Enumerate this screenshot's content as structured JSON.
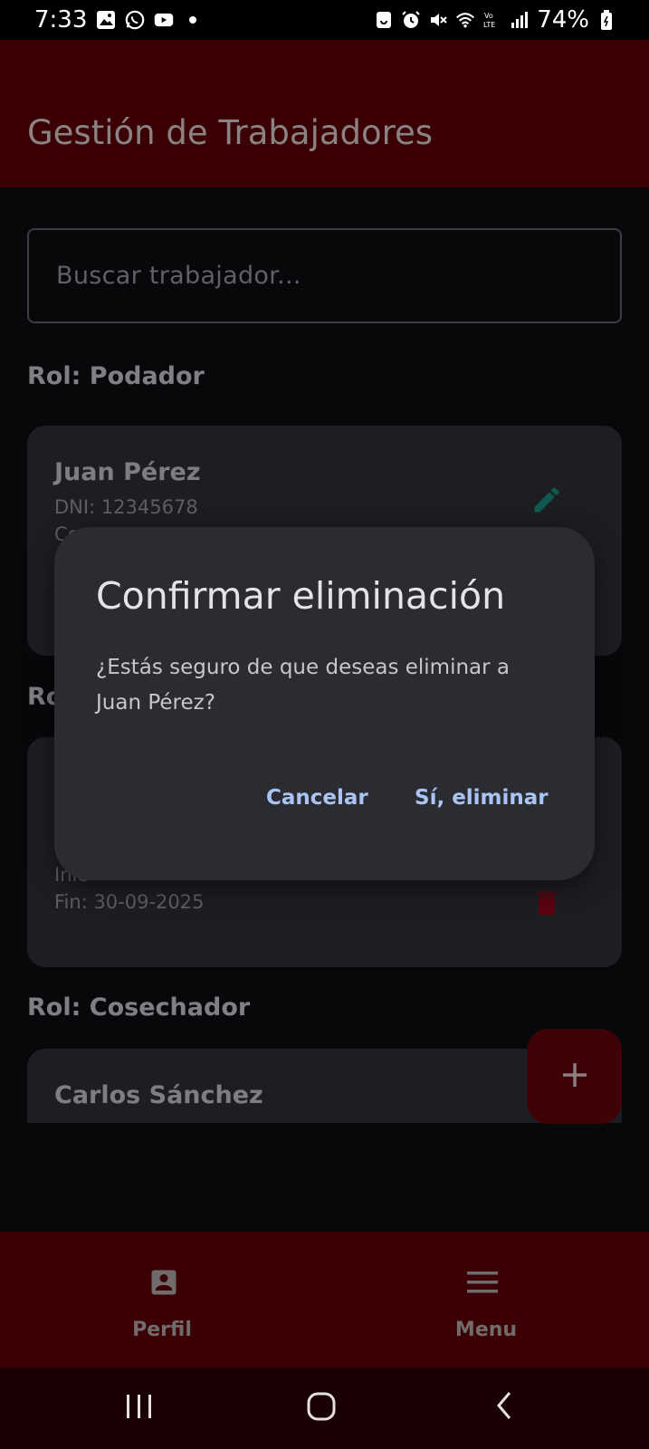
{
  "status_bar": {
    "time": "7:33",
    "battery": "74%",
    "left_icons": [
      "gallery-icon",
      "whatsapp-icon",
      "youtube-icon",
      "dot-icon"
    ],
    "right_icons": [
      "lock-icon",
      "alarm-icon",
      "mute-icon",
      "wifi-icon",
      "volte-icon",
      "signal-icon",
      "battery-icon"
    ]
  },
  "app_bar": {
    "title": "Gestión de Trabajadores"
  },
  "search": {
    "placeholder": "Buscar trabajador..."
  },
  "sections": [
    {
      "heading": "Rol: Podador",
      "card": {
        "name": "Juan Pérez",
        "lines": [
          "DNI: 12345678",
          "Co"
        ]
      }
    },
    {
      "heading": "Ro",
      "card": {
        "lines": [
          "Inic",
          "Fin: 30-09-2025"
        ]
      }
    },
    {
      "heading": "Rol: Cosechador",
      "card": {
        "name": "Carlos Sánchez"
      }
    }
  ],
  "dialog": {
    "title": "Confirmar eliminación",
    "message": "¿Estás seguro de que deseas eliminar a Juan Pérez?",
    "cancel_label": "Cancelar",
    "confirm_label": "Sí, eliminar"
  },
  "bottom_nav": [
    {
      "label": "Perfil",
      "icon": "profile-icon"
    },
    {
      "label": "Menu",
      "icon": "menu-icon"
    }
  ],
  "system_nav": [
    "recents-icon",
    "home-icon",
    "back-icon"
  ],
  "colors": {
    "app_bar": "#3a0004",
    "background": "#07080a",
    "card": "#1d1e22",
    "dialog": "#2b2c31",
    "dialog_button": "#a9c4f5",
    "edit_icon": "#0f5a4e",
    "delete_icon": "#5c0410"
  }
}
